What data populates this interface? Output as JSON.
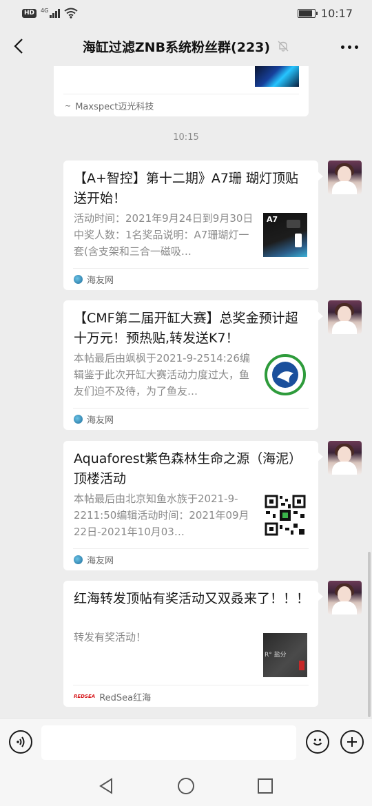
{
  "status_bar": {
    "hd_badge": "HD",
    "network": "4G",
    "time": "10:17",
    "battery_level": 0.85
  },
  "header": {
    "title": "海缸过滤ZNB系统粉丝群(223)",
    "muted": true
  },
  "chat": {
    "previous_card": {
      "source": "Maxspect迈光科技"
    },
    "timestamp": "10:15",
    "messages": [
      {
        "title": "【A+智控】第十二期》A7珊 瑚灯顶贴送开始！",
        "description": "活动时间：2021年9月24日到9月30日中奖人数：1名奖品说明：A7珊瑚灯一套(含支架和三合一磁吸…",
        "thumb_label": "A7",
        "source": "海友网"
      },
      {
        "title": "【CMF第二届开缸大赛】总奖金预计超十万元！预热贴,转发送K7！",
        "description": "本帖最后由飒枫于2021-9-2514:26编辑鉴于此次开缸大赛活动力度过大，鱼友们迫不及待，为了鱼友…",
        "source": "海友网"
      },
      {
        "title": "Aquaforest紫色森林生命之源（海泥）顶楼活动",
        "description": "本帖最后由北京知鱼水族于2021-9-2211:50编辑活动时间：2021年09月22日-2021年10月03…",
        "source": "海友网"
      },
      {
        "title": "红海转发顶帖有奖活动又双叒来了！！！",
        "description": "转发有奖活动！",
        "thumb_label": "R° 盐分",
        "source": "RedSea红海",
        "source_logo_text": "REDSEA"
      }
    ]
  },
  "input": {
    "placeholder": ""
  },
  "colors": {
    "background": "#ededed",
    "card": "#ffffff",
    "secondary_text": "#8a8a8a"
  }
}
